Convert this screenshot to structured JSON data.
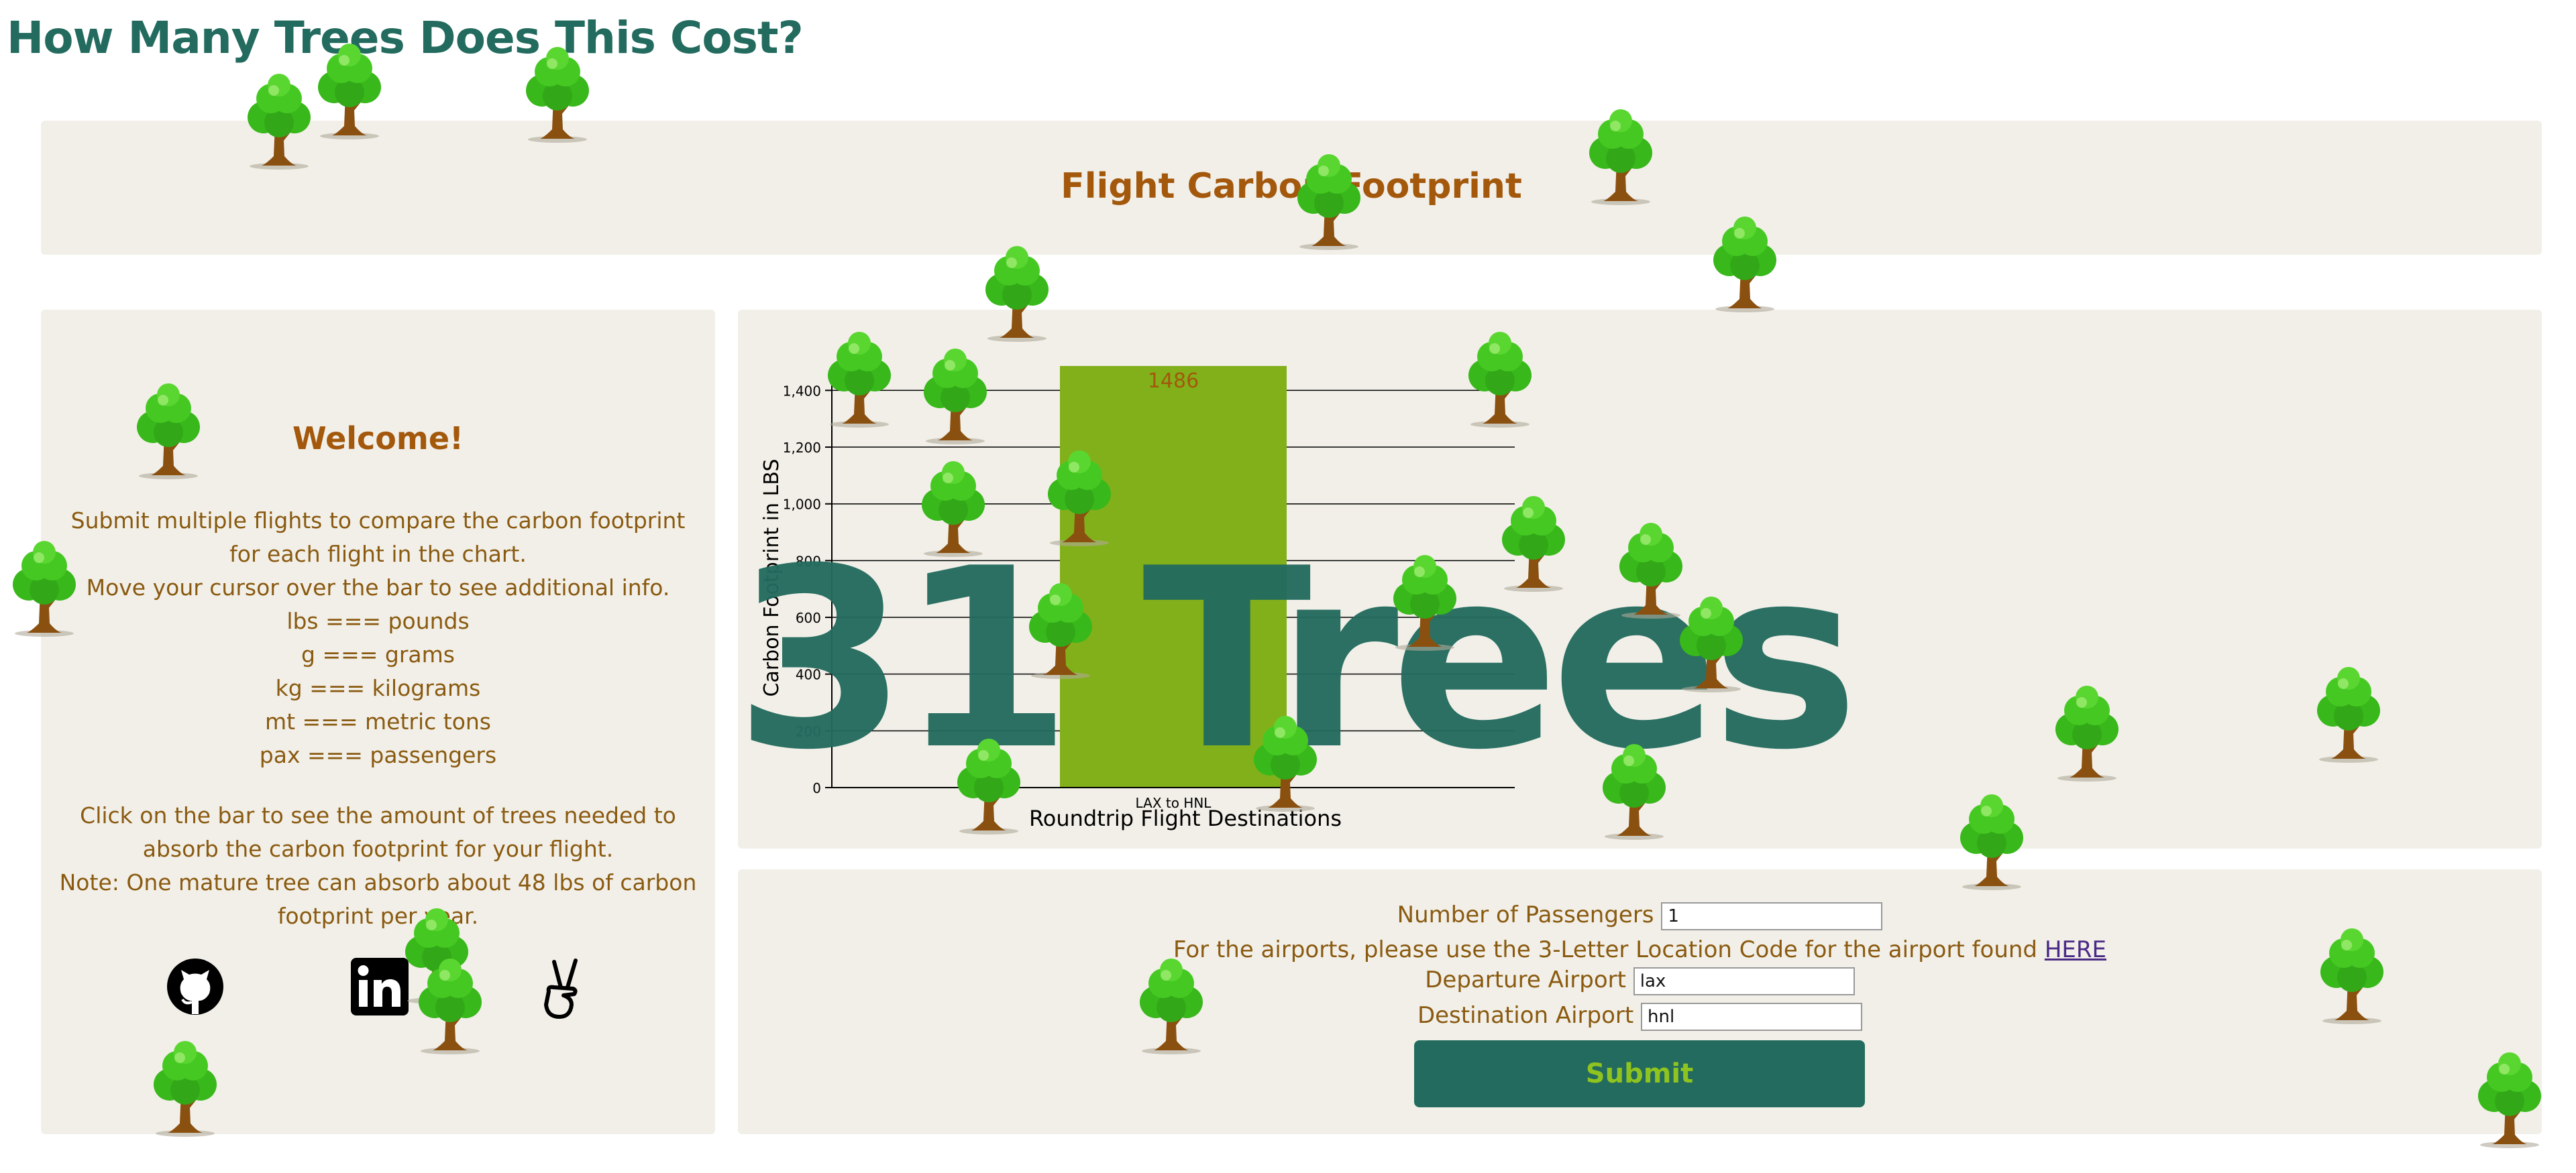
{
  "page": {
    "title": "How Many Trees Does This Cost?"
  },
  "header": {
    "title": "Flight Carbon Footprint"
  },
  "welcome": {
    "title": "Welcome!",
    "lines": [
      "Submit multiple flights to compare the carbon footprint for each flight in the chart.",
      "Move your cursor over the bar to see additional info.",
      "lbs === pounds",
      "g === grams",
      "kg === kilograms",
      "mt === metric tons",
      "pax === passengers"
    ],
    "lines2": [
      "Click on the bar to see the amount of trees needed to absorb the carbon footprint for your flight.",
      "Note: One mature tree can absorb about 48 lbs of carbon footprint per year."
    ],
    "social": [
      {
        "icon": "github-icon"
      },
      {
        "icon": "linkedin-icon"
      },
      {
        "icon": "angellist-icon"
      }
    ]
  },
  "chart_data": {
    "type": "bar",
    "categories": [
      "LAX to HNL"
    ],
    "values": [
      1486
    ],
    "data_labels": [
      "1486"
    ],
    "ylabel": "Carbon Footprint in LBS",
    "xlabel": "Roundtrip Flight Destinations",
    "ylim": [
      0,
      1486
    ],
    "yticks": [
      0,
      200,
      400,
      600,
      800,
      1000,
      1200,
      1400
    ],
    "ytick_labels": [
      "0",
      "200",
      "400",
      "600",
      "800",
      "1,000",
      "1,200",
      "1,400"
    ],
    "bar_color": "#82b01a",
    "grid": true
  },
  "overlay": {
    "tree_count_text": "31 Trees"
  },
  "form": {
    "passengers_label": "Number of Passengers",
    "passengers_value": "1",
    "note_text": "For the airports, please use the 3-Letter Location Code for the airport found",
    "note_link": "HERE",
    "departure_label": "Departure Airport",
    "departure_value": "lax",
    "destination_label": "Destination Airport",
    "destination_value": "hnl",
    "submit_label": "Submit"
  },
  "colors": {
    "accent": "#236b5e",
    "brand_orange": "#a3580c",
    "panel_bg": "#f1efe8",
    "tree_foliage": "#3fc21c",
    "tree_trunk": "#8a5010"
  }
}
